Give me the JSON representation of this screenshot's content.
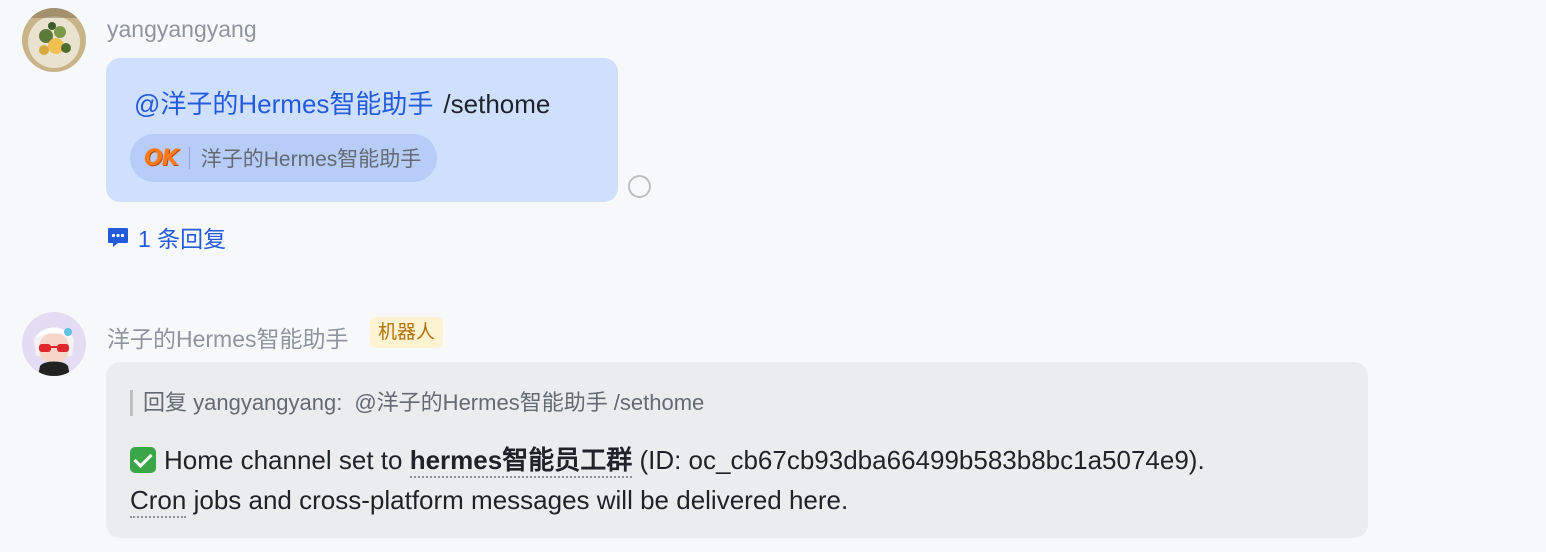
{
  "messages": [
    {
      "sender": "yangyangyang",
      "mention": "@洋子的Hermes智能助手",
      "command": "/sethome",
      "reaction": {
        "emoji_label": "OK",
        "user": "洋子的Hermes智能助手"
      },
      "thread_link": "1 条回复"
    },
    {
      "sender": "洋子的Hermes智能助手",
      "tag": "机器人",
      "quote_prefix": "回复 yangyangyang:",
      "quote_content": "@洋子的Hermes智能助手 /sethome",
      "reply": {
        "part1": "Home channel set to",
        "channel_name": "hermes智能员工群",
        "part2": "(ID: oc_cb67cb93dba66499b583b8bc1a5074e9).",
        "cron_word": "Cron",
        "part3": "jobs and cross-platform messages will be delivered here."
      }
    }
  ],
  "colors": {
    "link_blue": "#245bdb",
    "bubble_self": "#cfe0fe",
    "bubble_other": "#ebecee",
    "bot_tag_bg": "#fdf3d3",
    "bot_tag_text": "#b07309",
    "check_green": "#3aa648"
  },
  "icons": {
    "thread": "chat-bubble-dots-icon",
    "status": "read-status-circle-icon",
    "check": "white-check-mark-icon"
  }
}
